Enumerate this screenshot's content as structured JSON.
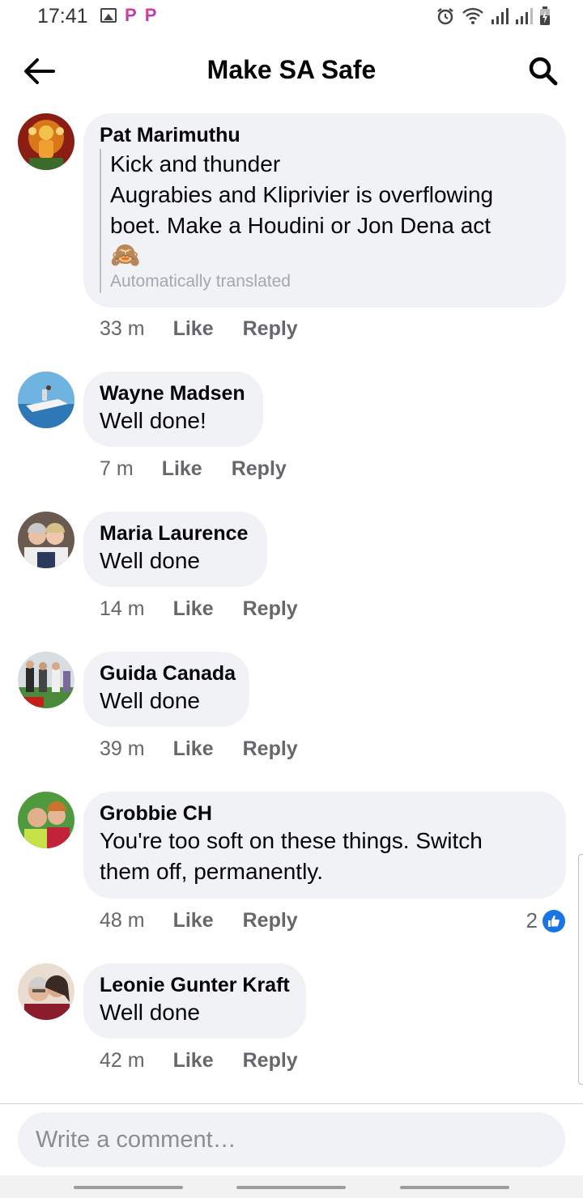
{
  "status_bar": {
    "time": "17:41"
  },
  "header": {
    "title": "Make SA Safe"
  },
  "comments": [
    {
      "author": "Pat Marimuthu",
      "lines": [
        "Kick and thunder",
        "Augrabies and Kliprivier is overflowing",
        "boet. Make a Houdini or Jon Dena act",
        "🙈"
      ],
      "translation_label": "Automatically translated",
      "time": "33 m",
      "like": "Like",
      "reply": "Reply"
    },
    {
      "author": "Wayne Madsen",
      "text": "Well done!",
      "time": "7 m",
      "like": "Like",
      "reply": "Reply"
    },
    {
      "author": "Maria Laurence",
      "text": "Well done",
      "time": "14 m",
      "like": "Like",
      "reply": "Reply"
    },
    {
      "author": "Guida Canada",
      "text": "Well done",
      "time": "39 m",
      "like": "Like",
      "reply": "Reply"
    },
    {
      "author": "Grobbie CH",
      "lines": [
        "You're too soft on these things. Switch",
        "them off, permanently."
      ],
      "time": "48 m",
      "like": "Like",
      "reply": "Reply",
      "reaction_count": "2"
    },
    {
      "author": "Leonie Gunter Kraft",
      "text": "Well done",
      "time": "42 m",
      "like": "Like",
      "reply": "Reply"
    }
  ],
  "composer": {
    "placeholder": "Write a comment…"
  },
  "colors": {
    "bubble": "#f0f2f5",
    "meta": "#65676b",
    "like_blue": "#1b74e4"
  }
}
